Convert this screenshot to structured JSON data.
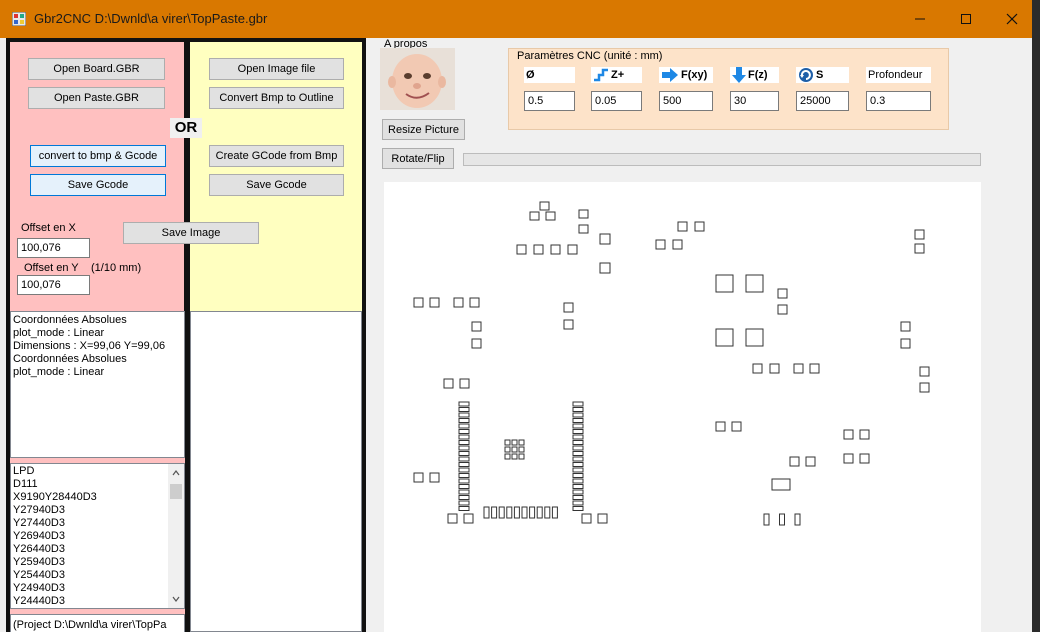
{
  "window": {
    "title": "Gbr2CNC D:\\Dwnld\\a virer\\TopPaste.gbr"
  },
  "left_panel": {
    "open_board": "Open Board.GBR",
    "open_paste": "Open Paste.GBR",
    "convert": "convert to bmp & Gcode",
    "save_gcode": "Save Gcode",
    "offset_x_label": "Offset en X",
    "offset_x_value": "100,076",
    "offset_y_label": "Offset en Y",
    "offset_unit": "(1/10 mm)",
    "offset_y_value": "100,076",
    "log_lines": [
      "Coordonnées Absolues",
      "plot_mode : Linear",
      "Dimensions : X=99,06 Y=99,06",
      "Coordonnées Absolues",
      "plot_mode : Linear"
    ],
    "gcode_lines": [
      "LPD",
      "D111",
      "X9190Y28440D3",
      "Y27940D3",
      "Y27440D3",
      "Y26940D3",
      "Y26440D3",
      "Y25940D3",
      "Y25440D3",
      "Y24940D3",
      "Y24440D3"
    ],
    "status_line": "(Project D:\\Dwnld\\a virer\\TopPa"
  },
  "or_label": "OR",
  "right_panel": {
    "open_image": "Open Image file",
    "convert_bmp": "Convert Bmp to Outline",
    "create_gcode": "Create GCode from Bmp",
    "save_gcode": "Save Gcode"
  },
  "save_image": "Save Image",
  "about_label": "A propos",
  "resize_picture": "Resize Picture",
  "rotate_flip": "Rotate/Flip",
  "progress": 0,
  "cnc": {
    "legend": "Paramètres CNC (unité : mm)",
    "params": [
      {
        "label": "Ø",
        "value": "0.5",
        "icon": "diameter-icon"
      },
      {
        "label": "Z+",
        "value": "0.05",
        "icon": "step-up-icon"
      },
      {
        "label": "F(xy)",
        "value": "500",
        "icon": "arrow-right-icon"
      },
      {
        "label": "F(z)",
        "value": "30",
        "icon": "arrow-down-icon"
      },
      {
        "label": "S",
        "value": "25000",
        "icon": "rotate-icon"
      },
      {
        "label": "Profondeur",
        "value": "0.3",
        "icon": ""
      }
    ]
  },
  "colors": {
    "titlebar": "#d97800",
    "left_panel": "#ffc0c0",
    "right_panel": "#ffffc0",
    "cnc_box": "#fde3c9",
    "accent": "#0078d7"
  }
}
